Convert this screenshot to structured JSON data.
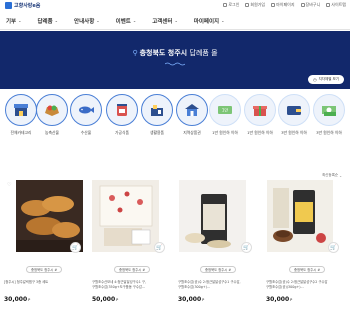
{
  "header": {
    "logo_text": "고향사랑e음",
    "utils": [
      {
        "label": "로그인",
        "icon": "lock-icon"
      },
      {
        "label": "회원가입",
        "icon": "user-plus-icon"
      },
      {
        "label": "마이페이지",
        "icon": "person-icon"
      },
      {
        "label": "장바구니",
        "icon": "cart-icon"
      },
      {
        "label": "사이트맵",
        "icon": "grid-icon"
      }
    ]
  },
  "nav": {
    "items": [
      "기부",
      "답례품",
      "안내사항",
      "이벤트",
      "고객센터",
      "마이페이지"
    ]
  },
  "hero": {
    "title_bold": "충청북도 청주시",
    "title_light": "답례품 몰",
    "button_label": "지자체별 보기"
  },
  "categories": [
    "전체카테고리",
    "농축산물",
    "수산물",
    "가공식품",
    "생활용품",
    "지역상품권",
    "1만 원인하 이하",
    "1만 원인하 이하",
    "3만 원인하 이하",
    "3만 원인하 이하",
    "5만 원인하 이하"
  ],
  "sort_label": "최신등록순",
  "products": [
    {
      "tag": "충청북도 청주시 #",
      "desc": [
        "[청주시] 청주갈릭찜구 3종 세트"
      ],
      "price": "30,000",
      "unit": "P"
    },
    {
      "tag": "충청북도 청주시 #",
      "desc": [
        "구월조수산모네 4:청근달달성구수1 구,",
        "구월조수감(350g+도구품동 구수감..."
      ],
      "price": "50,000",
      "unit": "P"
    },
    {
      "tag": "충청북도 청주시 #",
      "desc": [
        "구월조수감(공)수 2:청근달달성구수1 구수감,",
        "구월조수감(300g+)..."
      ],
      "price": "30,000",
      "unit": "P"
    },
    {
      "tag": "충청북도 청주시 #",
      "desc": [
        "구월조수감(공)수 2:청근달달성구수2 구수감",
        "구월조수감(공)(300g+)..."
      ],
      "price": "30,000",
      "unit": "P"
    }
  ],
  "colors": {
    "hero_bg": "#12286b",
    "accent": "#2a6fd6",
    "circle_border": "#4a7fd6"
  }
}
